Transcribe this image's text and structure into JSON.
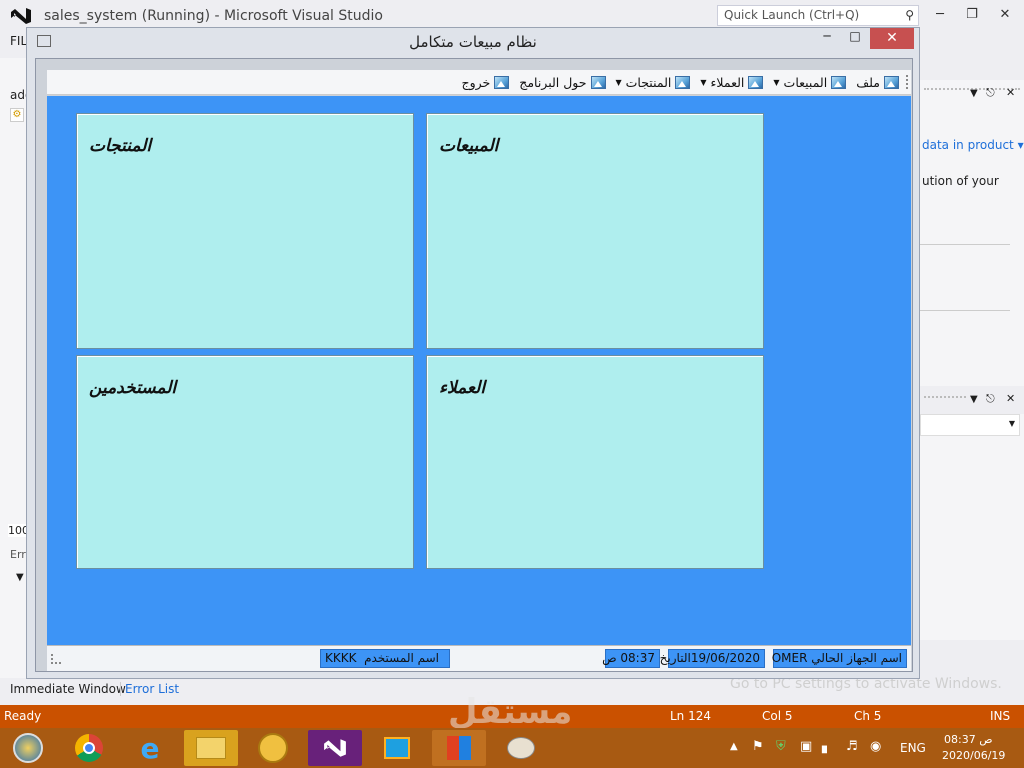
{
  "vs": {
    "window_title": "sales_system (Running) - Microsoft Visual Studio",
    "quick_launch_placeholder": "Quick Launch (Ctrl+Q)",
    "menu_first": "FIL",
    "left_labels": [
      "ado",
      "100",
      "Erro"
    ],
    "right_panel": {
      "link": "data in product",
      "text": "ution of your"
    },
    "bottom_tabs": [
      "Immediate Window",
      "Error List"
    ],
    "statusbar": {
      "ready": "Ready",
      "ln": "Ln 124",
      "col": "Col 5",
      "ch": "Ch 5",
      "mode": "INS"
    },
    "watermark": "Go to PC settings to activate Windows.",
    "brand_watermark": "مستقل",
    "colors": {
      "statusbar": "#ca5100",
      "accent": "#68217a"
    }
  },
  "app": {
    "title": "نظام مبيعات متكامل",
    "menu": [
      {
        "label": "ملف",
        "icon": "picture-icon",
        "dropdown": false
      },
      {
        "label": "المبيعات",
        "icon": "picture-icon",
        "dropdown": true
      },
      {
        "label": "العملاء",
        "icon": "picture-icon",
        "dropdown": true
      },
      {
        "label": "المنتجات",
        "icon": "picture-icon",
        "dropdown": true
      },
      {
        "label": "حول البرنامج",
        "icon": "picture-icon",
        "dropdown": false
      },
      {
        "label": "خروج",
        "icon": "picture-icon",
        "dropdown": false
      }
    ],
    "panels": {
      "products": "المنتجات",
      "sales": "المبيعات",
      "users": "المستخدمين",
      "customers": "العملاء"
    },
    "status": {
      "user_label": "اسم المستخدم",
      "user_value": "KKKK",
      "time": "08:37 ص",
      "date": "19/06/2020التاريخ",
      "machine": "اسم الجهاز الحالي OMER"
    },
    "colors": {
      "body": "#3d94f6",
      "panel": "#afeeee"
    }
  },
  "taskbar": {
    "clock_time": "08:37 ص",
    "clock_date": "2020/06/19",
    "lang": "ENG"
  }
}
